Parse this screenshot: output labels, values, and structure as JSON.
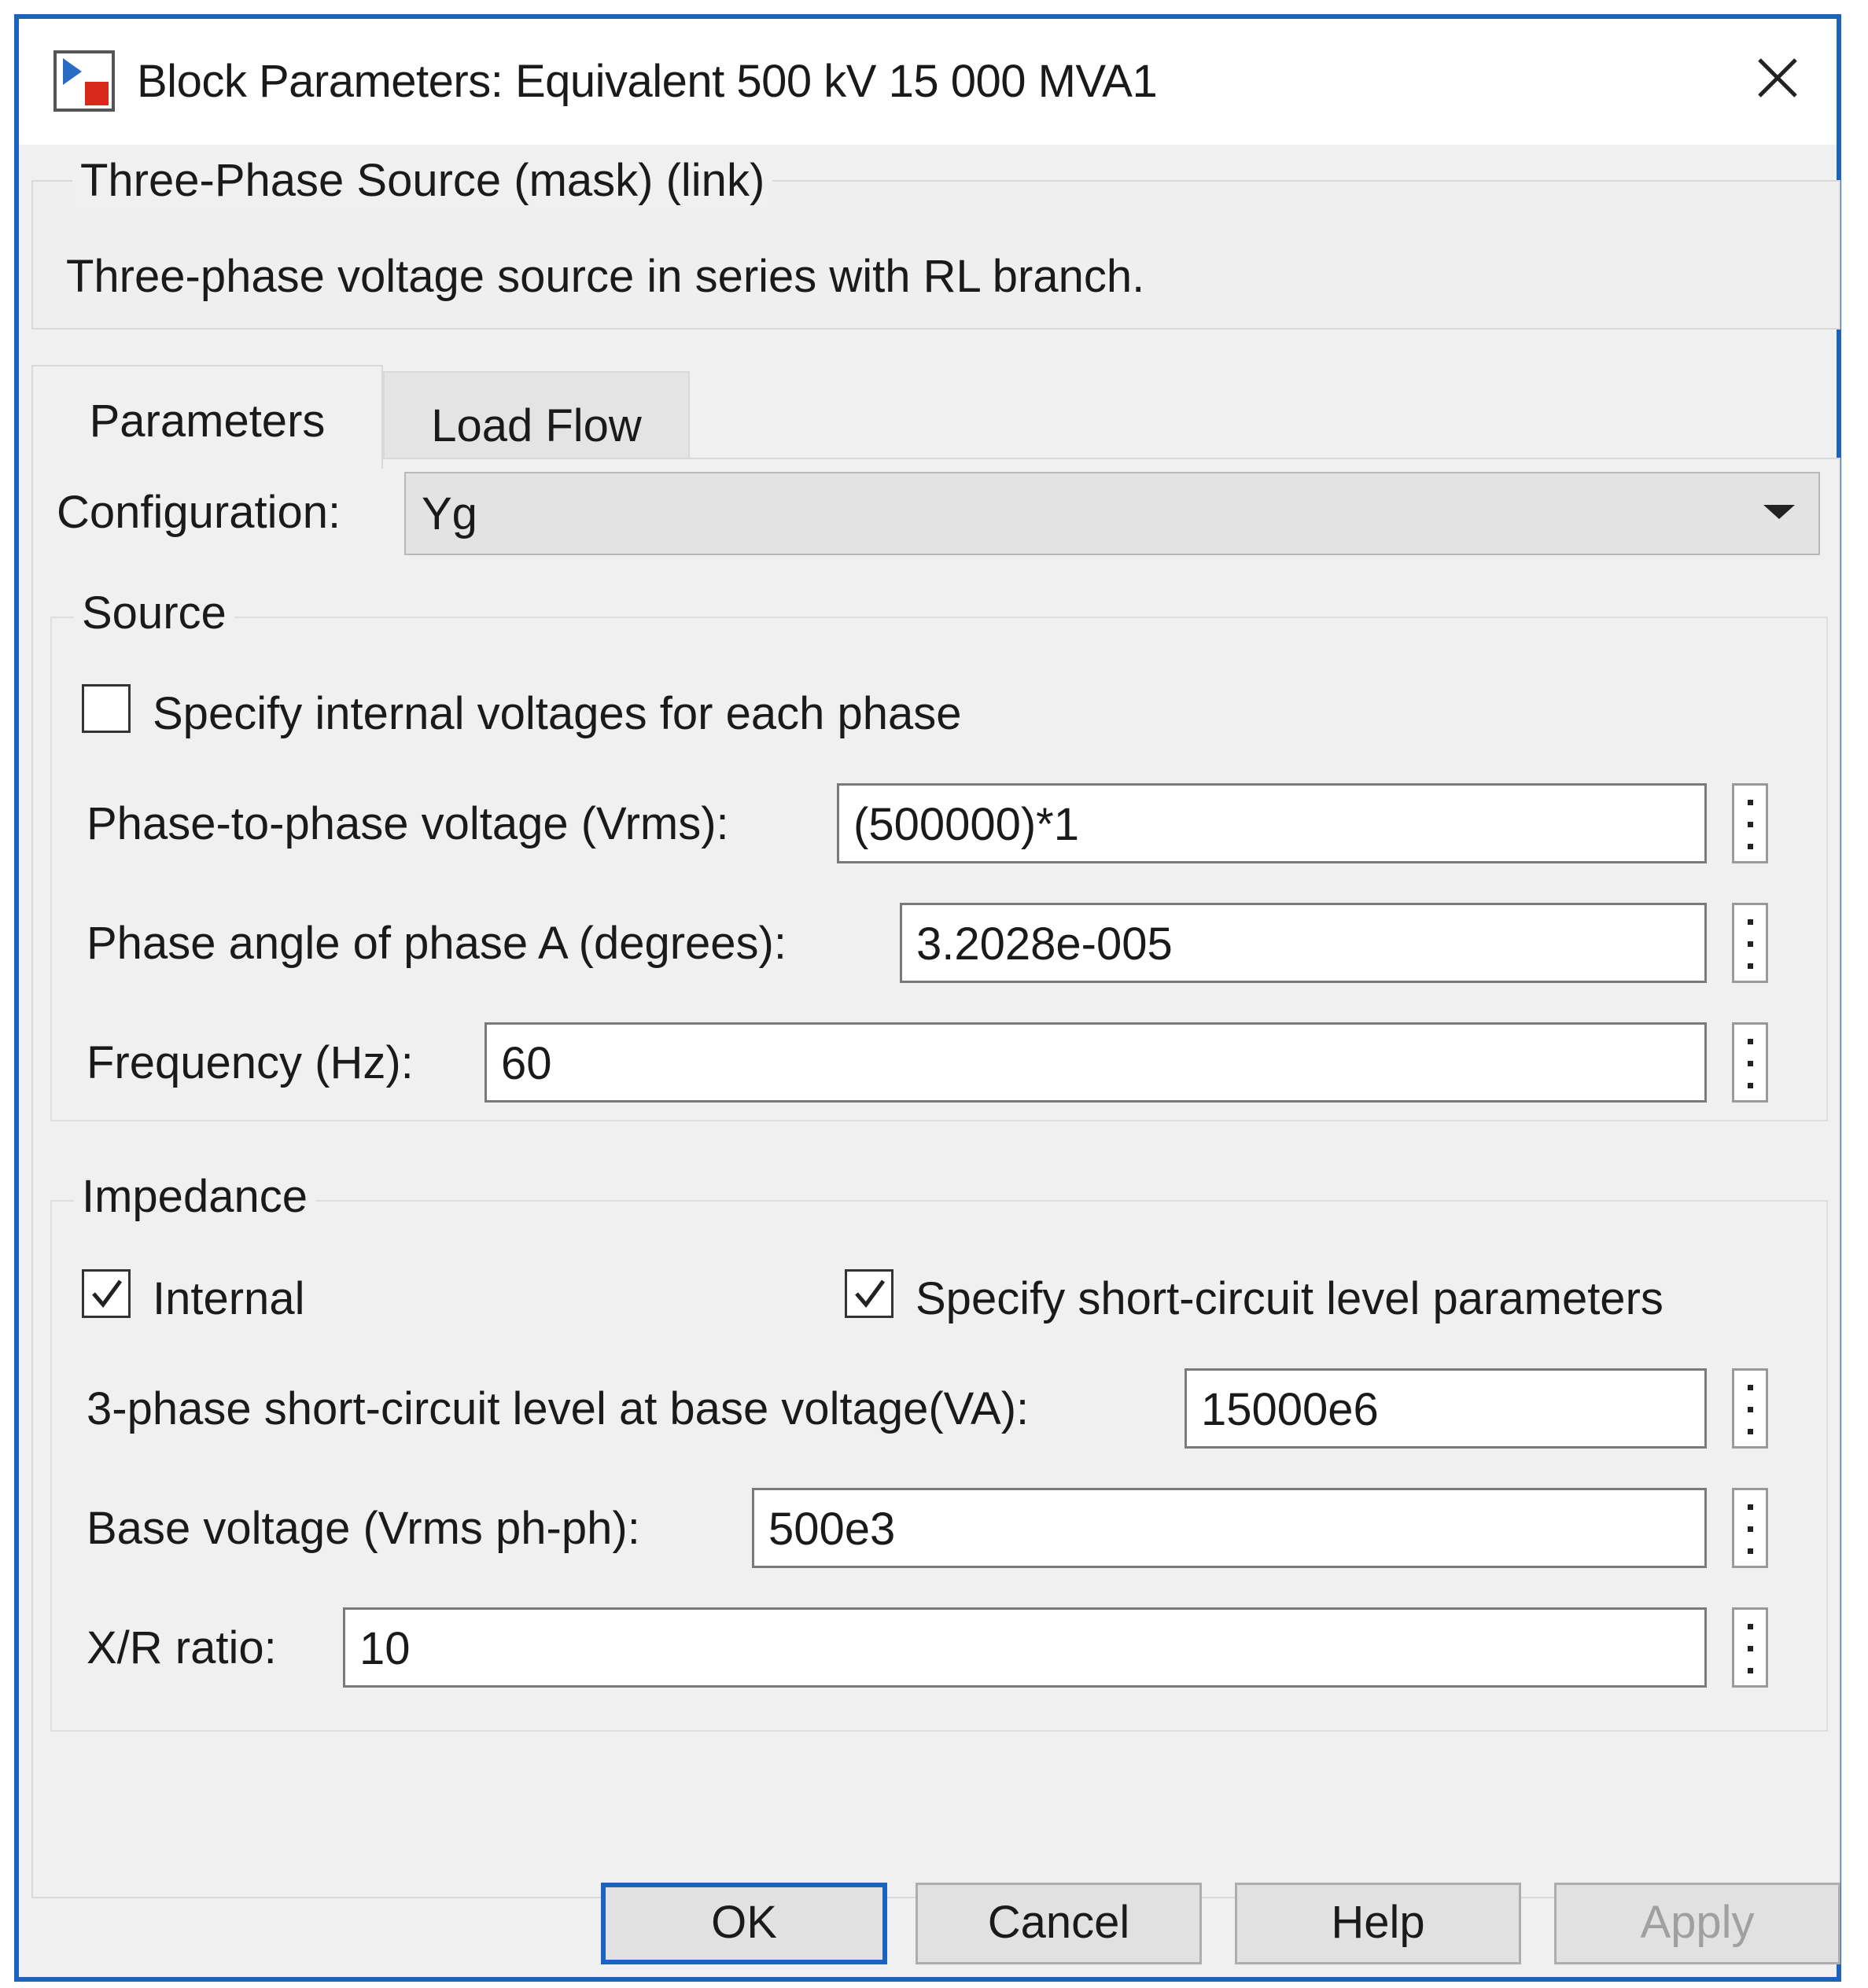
{
  "window": {
    "title": "Block Parameters: Equivalent 500 kV 15 000 MVA1",
    "accent_color": "#1a63c0",
    "icons": {
      "app": "simulink-block-icon",
      "close": "close-icon"
    }
  },
  "mask": {
    "title": "Three-Phase Source (mask) (link)",
    "description": "Three-phase voltage source in series with RL branch."
  },
  "tabs": [
    {
      "label": "Parameters",
      "selected": true
    },
    {
      "label": "Load Flow",
      "selected": false
    }
  ],
  "configuration": {
    "label": "Configuration:",
    "value": "Yg"
  },
  "source": {
    "group_title": "Source",
    "specify_internal": {
      "label": "Specify internal voltages for each phase",
      "checked": false
    },
    "fields": [
      {
        "label": "Phase-to-phase voltage (Vrms):",
        "value": "(500000)*1"
      },
      {
        "label": "Phase angle of phase A (degrees):",
        "value": "3.2028e-005"
      },
      {
        "label": "Frequency (Hz):",
        "value": "60"
      }
    ]
  },
  "impedance": {
    "group_title": "Impedance",
    "internal": {
      "label": "Internal",
      "checked": true
    },
    "short_circuit": {
      "label": "Specify short-circuit level parameters",
      "checked": true
    },
    "fields": [
      {
        "label": "3-phase short-circuit level at base voltage(VA):",
        "value": "15000e6"
      },
      {
        "label": "Base voltage (Vrms ph-ph):",
        "value": "500e3"
      },
      {
        "label": "X/R ratio:",
        "value": "10"
      }
    ]
  },
  "buttons": {
    "ok": "OK",
    "cancel": "Cancel",
    "help": "Help",
    "apply": "Apply"
  }
}
